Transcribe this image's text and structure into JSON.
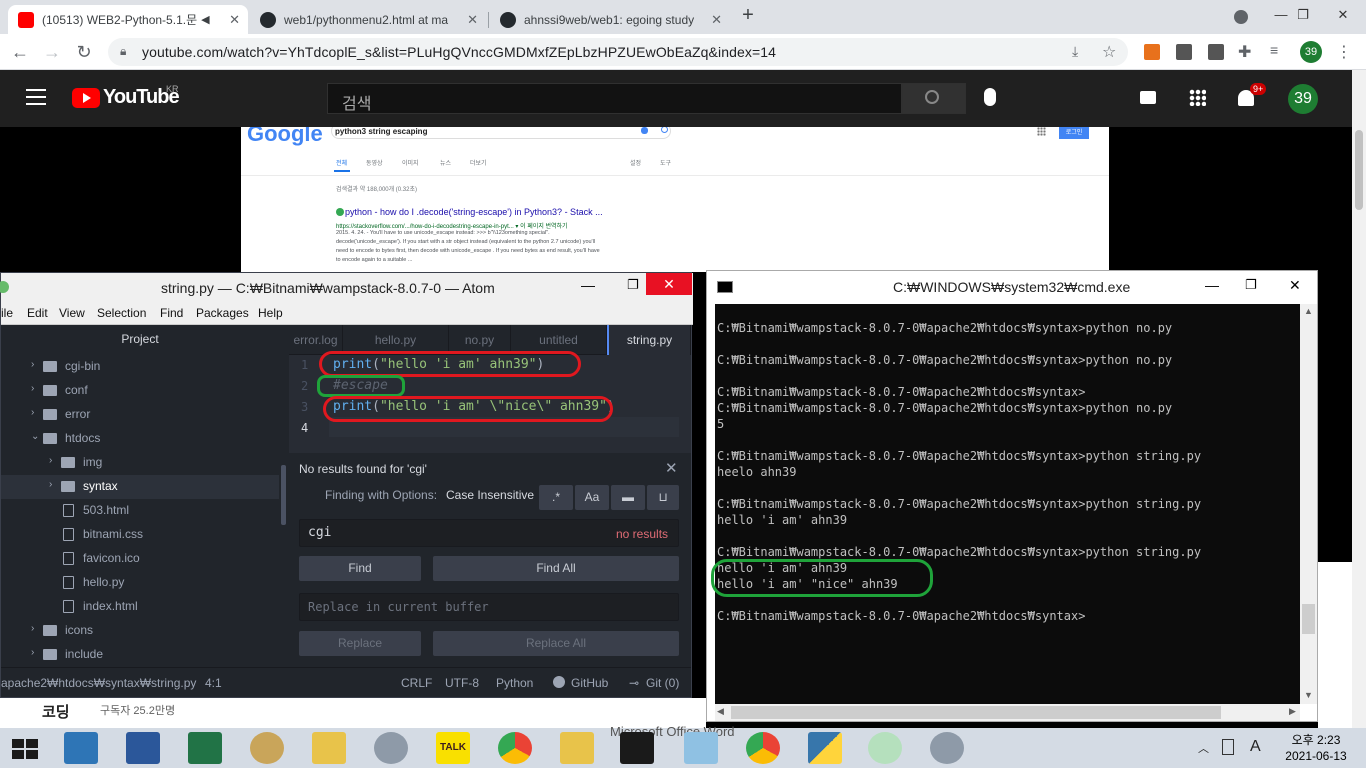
{
  "browser": {
    "tabs": [
      {
        "title": "(10513) WEB2-Python-5.1.문",
        "active": true
      },
      {
        "title": "web1/pythonmenu2.html at ma",
        "active": false
      },
      {
        "title": "ahnssi9web/web1: egoing study",
        "active": false
      }
    ],
    "new_tab": "+",
    "url": "youtube.com/watch?v=YhTdcoplE_s&list=PLuHgQVnccGMDMxfZEpLbzHPZUEwObEaZq&index=14",
    "profile_badge": "39"
  },
  "youtube": {
    "logo_text": "YouTube",
    "region": "KR",
    "search_placeholder": "검색",
    "notif_count": "9+",
    "avatar": "39",
    "channel_name": "코딩",
    "subscribers": "구독자 25.2만명"
  },
  "google_page": {
    "logo": "Google",
    "query": "python3 string escaping",
    "signin": "로그인",
    "tabs": [
      "전체",
      "동영상",
      "이미지",
      "뉴스",
      "더보기",
      "설정",
      "도구"
    ],
    "count": "검색결과 약 188,000개 (0.32초)",
    "result_title": "python - how do I .decode('string-escape') in Python3? - Stack ...",
    "result_url": "https://stackoverflow.com/.../how-do-i-decodestring-escape-in-pyt... ▾ 이 페이지 번역하기",
    "snippet": [
      "2015. 4. 24. - You'll have to use unicode_escape instead: >>> b\"\\\\123omething special\".",
      "decode('unicode_escape'). If you start with a str object instead (equivalent to the python 2.7 unicode) you'll",
      "need to encode to bytes first, then decode with unicode_escape . If you need bytes as end result, you'll have",
      "to encode again to a suitable ..."
    ]
  },
  "atom": {
    "title": "string.py — C:₩Bitnami₩wampstack-8.0.7-0 — Atom",
    "menu": [
      "ile",
      "Edit",
      "View",
      "Selection",
      "Find",
      "Packages",
      "Help"
    ],
    "tree_header": "Project",
    "tree": [
      {
        "label": "cgi-bin",
        "type": "folder",
        "depth": 1,
        "arrow": "›"
      },
      {
        "label": "conf",
        "type": "folder",
        "depth": 1,
        "arrow": "›"
      },
      {
        "label": "error",
        "type": "folder",
        "depth": 1,
        "arrow": "›"
      },
      {
        "label": "htdocs",
        "type": "folder",
        "depth": 1,
        "arrow": "⌄"
      },
      {
        "label": "img",
        "type": "folder",
        "depth": 2,
        "arrow": "›"
      },
      {
        "label": "syntax",
        "type": "folder",
        "depth": 2,
        "arrow": "›",
        "selected": true
      },
      {
        "label": "503.html",
        "type": "file",
        "depth": 2
      },
      {
        "label": "bitnami.css",
        "type": "file",
        "depth": 2
      },
      {
        "label": "favicon.ico",
        "type": "file",
        "depth": 2
      },
      {
        "label": "hello.py",
        "type": "file",
        "depth": 2
      },
      {
        "label": "index.html",
        "type": "file",
        "depth": 2
      },
      {
        "label": "icons",
        "type": "folder",
        "depth": 1,
        "arrow": "›"
      },
      {
        "label": "include",
        "type": "folder",
        "depth": 1,
        "arrow": "›"
      }
    ],
    "editor_tabs": [
      "error.log",
      "hello.py",
      "no.py",
      "untitled",
      "string.py"
    ],
    "lines": [
      "1",
      "2",
      "3",
      "4"
    ],
    "code": {
      "l1_fn": "print",
      "l1_open": "(",
      "l1_str": "\"hello 'i am' ahn39\"",
      "l1_close": ")",
      "l2_comment": "#escape",
      "l3_fn": "print",
      "l3_open": "(",
      "l3_str": "\"hello 'i am' \\\"nice\\\" ahn39\"",
      "l3_close": ")"
    },
    "find": {
      "message": "No results found for 'cgi'",
      "options_label": "Finding with Options:",
      "options_value": "Case Insensitive",
      "opt_regex": ".*",
      "opt_case": "Aa",
      "query": "cgi",
      "result": "no results",
      "find_btn": "Find",
      "find_all_btn": "Find All",
      "replace_placeholder": "Replace in current buffer",
      "replace_btn": "Replace",
      "replace_all_btn": "Replace All"
    },
    "status": {
      "path": "apache2₩htdocs₩syntax₩string.py",
      "cursor": "4:1",
      "line_ending": "CRLF",
      "encoding": "UTF-8",
      "grammar": "Python",
      "github": "GitHub",
      "git": "Git (0)"
    }
  },
  "cmd": {
    "title": "C:₩WINDOWS₩system32₩cmd.exe",
    "lines": [
      "C:₩Bitnami₩wampstack-8.0.7-0₩apache2₩htdocs₩syntax>python no.py",
      "",
      "C:₩Bitnami₩wampstack-8.0.7-0₩apache2₩htdocs₩syntax>python no.py",
      "",
      "C:₩Bitnami₩wampstack-8.0.7-0₩apache2₩htdocs₩syntax>",
      "C:₩Bitnami₩wampstack-8.0.7-0₩apache2₩htdocs₩syntax>python no.py",
      "5",
      "",
      "C:₩Bitnami₩wampstack-8.0.7-0₩apache2₩htdocs₩syntax>python string.py",
      "heelo ahn39",
      "",
      "C:₩Bitnami₩wampstack-8.0.7-0₩apache2₩htdocs₩syntax>python string.py",
      "hello 'i am' ahn39",
      "",
      "C:₩Bitnami₩wampstack-8.0.7-0₩apache2₩htdocs₩syntax>python string.py",
      "hello 'i am' ahn39",
      "hello 'i am' \"nice\" ahn39",
      "",
      "C:₩Bitnami₩wampstack-8.0.7-0₩apache2₩htdocs₩syntax>"
    ]
  },
  "taskbar": {
    "behind_label": "Microsoft Office Word",
    "time": "오후 2:23",
    "date": "2021-06-13",
    "ime": "A"
  },
  "colors": {
    "annotation_red": "#e0181f",
    "annotation_green": "#1fa33a",
    "yt_red": "#ff0000"
  }
}
